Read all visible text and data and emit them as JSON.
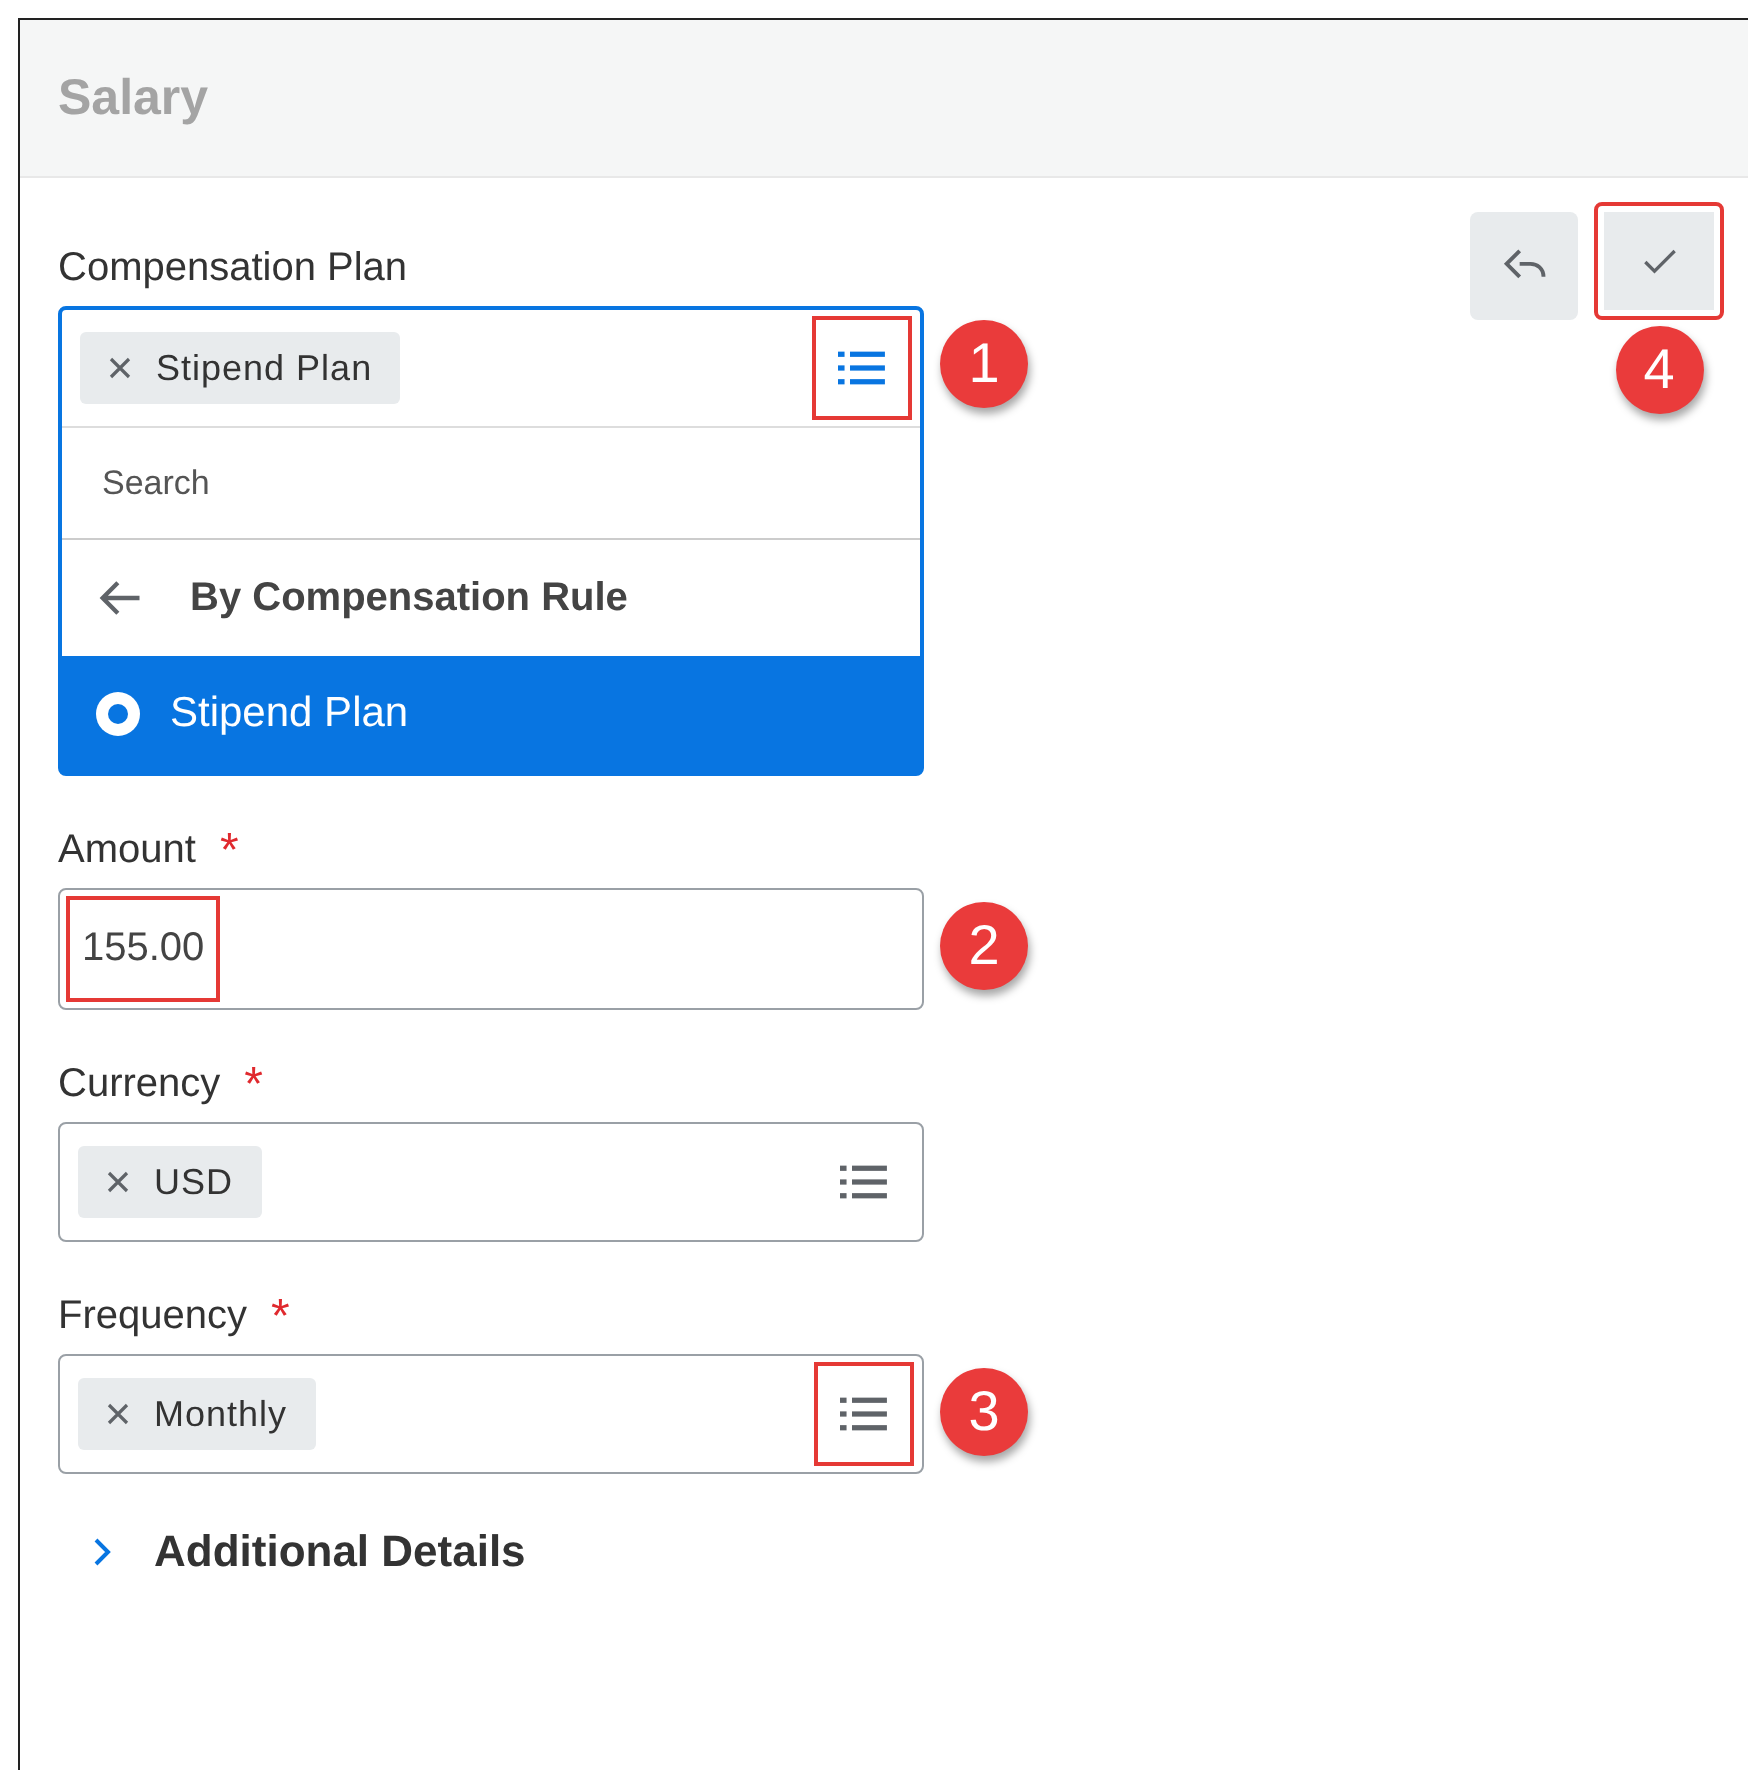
{
  "header": {
    "title": "Salary"
  },
  "actions": [
    {
      "kind": "undo",
      "highlighted": false
    },
    {
      "kind": "save",
      "highlighted": true,
      "callout": "4"
    }
  ],
  "fields": [
    {
      "kind": "select",
      "label": "Compensation Plan",
      "chip": "Stipend Plan",
      "list_highlighted": true,
      "expanded": true,
      "callout": "1",
      "search_placeholder": "Search",
      "options": [
        {
          "kind": "back",
          "label": "By Compensation Rule",
          "selected": false
        },
        {
          "kind": "radio",
          "label": "Stipend Plan",
          "selected": true
        }
      ]
    },
    {
      "kind": "text",
      "label": "Amount",
      "required_mark": "*",
      "value": "155.00",
      "value_highlighted": true,
      "callout": "2"
    },
    {
      "kind": "select",
      "label": "Currency",
      "required_mark": "*",
      "chip": "USD",
      "list_highlighted": false,
      "expanded": false
    },
    {
      "kind": "select",
      "label": "Frequency",
      "required_mark": "*",
      "chip": "Monthly",
      "list_highlighted": true,
      "expanded": false,
      "callout": "3"
    }
  ],
  "section": {
    "label": "Additional Details",
    "expanded": false
  }
}
